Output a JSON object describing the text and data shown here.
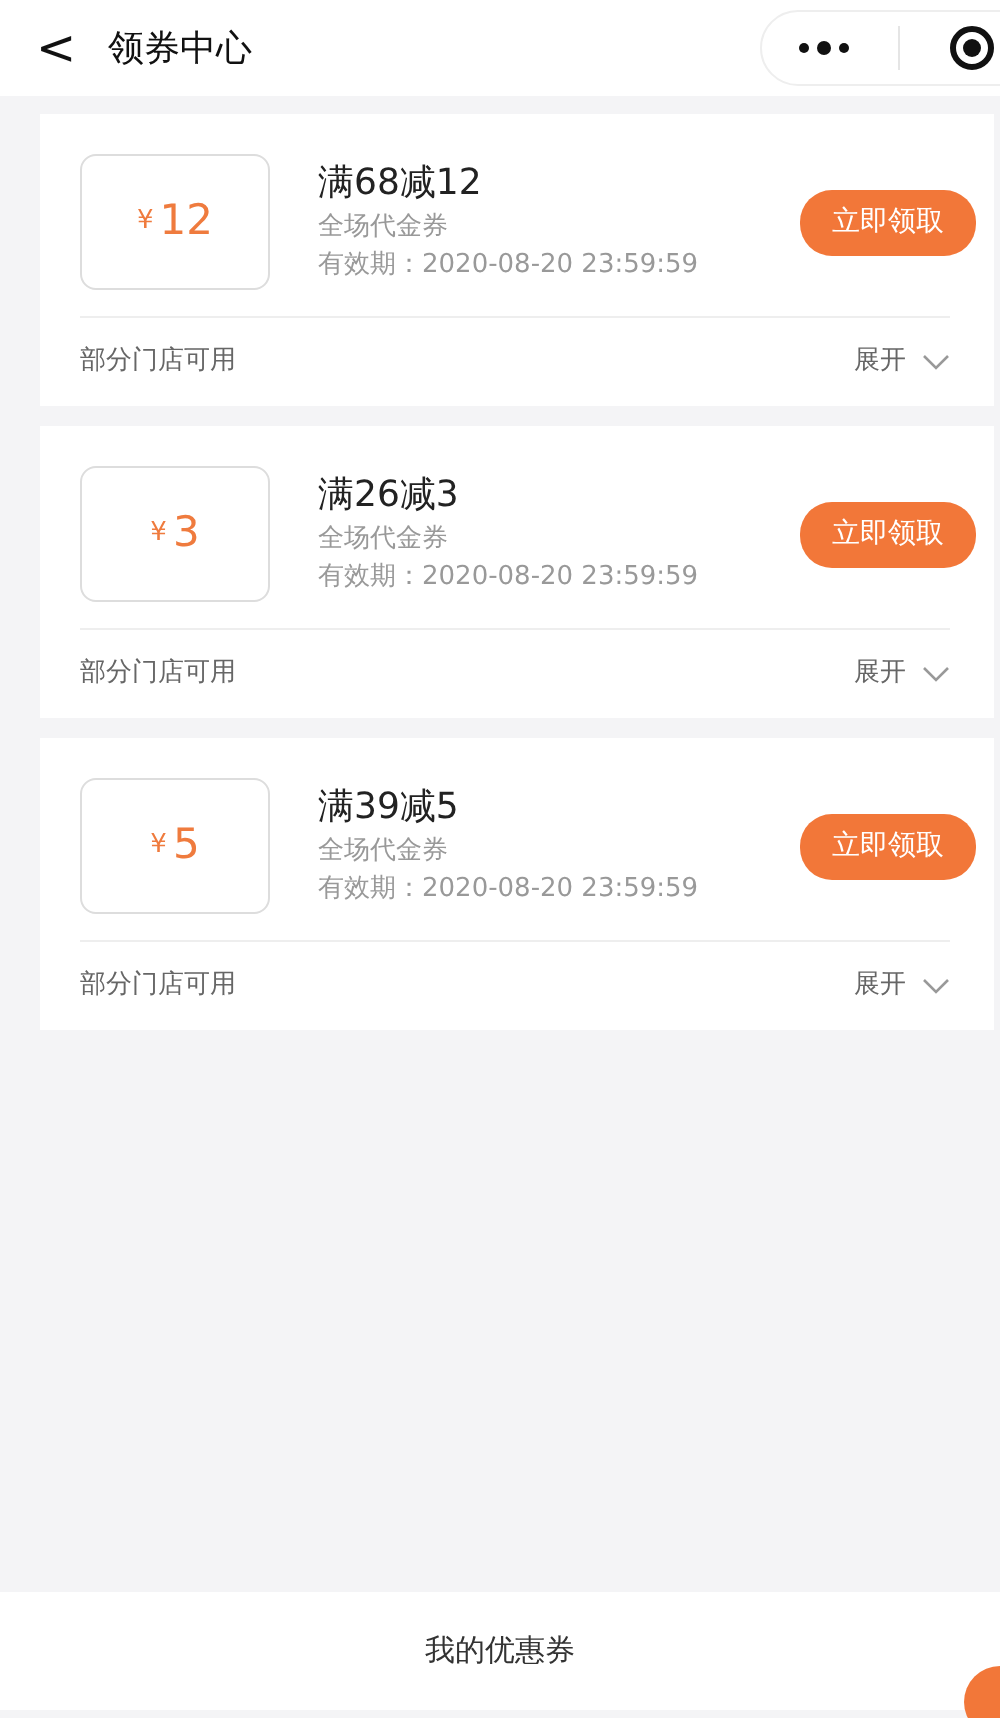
{
  "header": {
    "back": "<",
    "title": "领券中心"
  },
  "coupons": [
    {
      "currency": "¥",
      "amount": "12",
      "title": "满68减12",
      "scope": "全场代金券",
      "validity": "有效期：2020-08-20 23:59:59",
      "action": "立即领取",
      "stores": "部分门店可用",
      "expand": "展开"
    },
    {
      "currency": "¥",
      "amount": "3",
      "title": "满26减3",
      "scope": "全场代金券",
      "validity": "有效期：2020-08-20 23:59:59",
      "action": "立即领取",
      "stores": "部分门店可用",
      "expand": "展开"
    },
    {
      "currency": "¥",
      "amount": "5",
      "title": "满39减5",
      "scope": "全场代金券",
      "validity": "有效期：2020-08-20 23:59:59",
      "action": "立即领取",
      "stores": "部分门店可用",
      "expand": "展开"
    }
  ],
  "footer": {
    "label": "我的优惠券"
  }
}
